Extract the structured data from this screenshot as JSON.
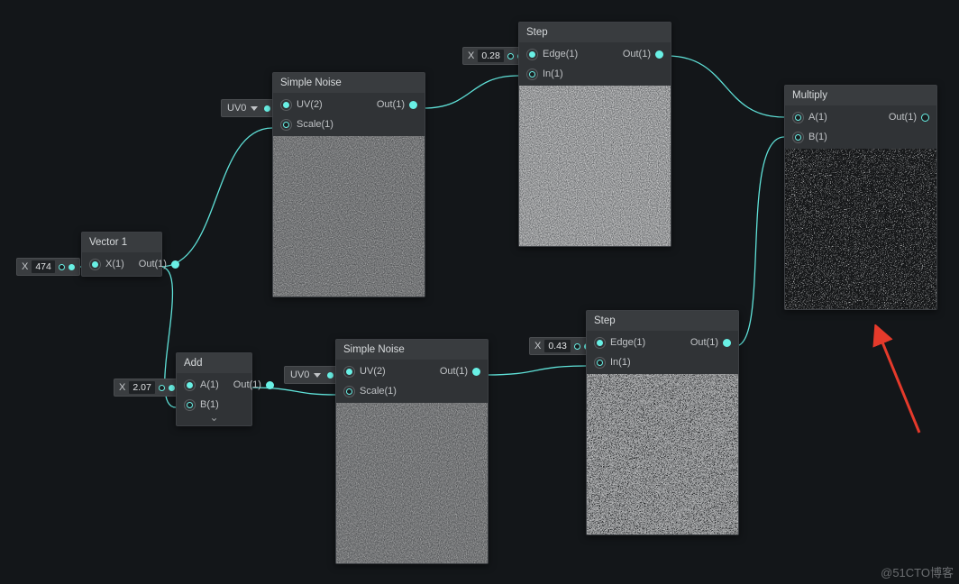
{
  "labels": {
    "x": "X",
    "uv0": "UV0",
    "out1": "Out(1)",
    "uv2": "UV(2)",
    "scale1": "Scale(1)",
    "edge1": "Edge(1)",
    "in1": "In(1)",
    "a1": "A(1)",
    "b1": "B(1)",
    "x1": "X(1)"
  },
  "nodes": {
    "vector1": {
      "title": "Vector 1",
      "input_value": "474"
    },
    "add": {
      "title": "Add",
      "input_value": "2.07"
    },
    "noise_top": {
      "title": "Simple Noise"
    },
    "noise_bot": {
      "title": "Simple Noise"
    },
    "step_top": {
      "title": "Step",
      "input_value": "0.28"
    },
    "step_bot": {
      "title": "Step",
      "input_value": "0.43"
    },
    "multiply": {
      "title": "Multiply"
    }
  },
  "watermark": "@51CTO博客",
  "colors": {
    "wire": "#5fe1d8",
    "panel": "#303336",
    "bg": "#131619"
  }
}
